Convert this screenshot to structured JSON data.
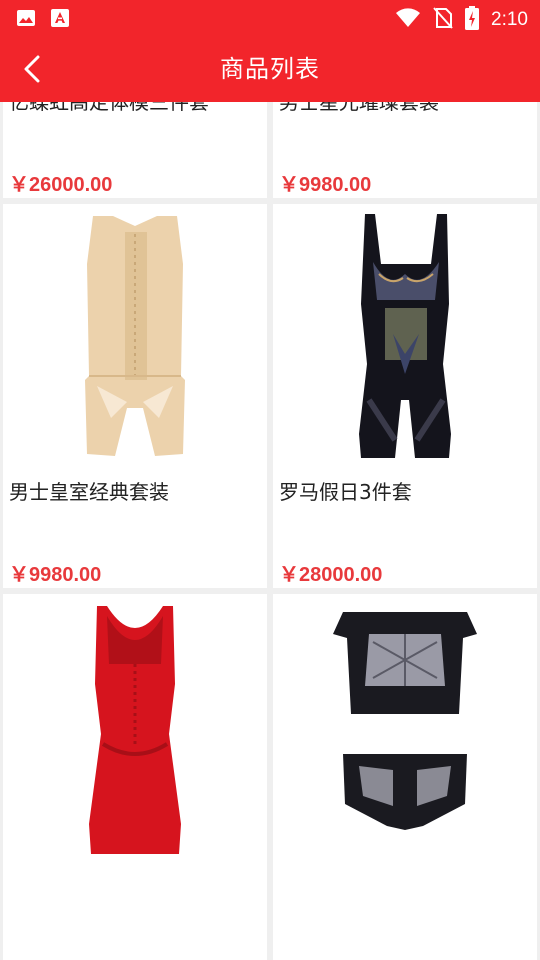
{
  "status_bar": {
    "time": "2:10"
  },
  "app_bar": {
    "title": "商品列表"
  },
  "products": [
    {
      "name": "亿蝶虹高定体模三件套",
      "price": "￥26000.00"
    },
    {
      "name": "男士星光璀璨套装",
      "price": "￥9980.00"
    },
    {
      "name": "男士皇室经典套装",
      "price": "￥9980.00"
    },
    {
      "name": "罗马假日3件套",
      "price": "￥28000.00"
    },
    {
      "name": "",
      "price": ""
    },
    {
      "name": "",
      "price": ""
    }
  ],
  "colors": {
    "brand": "#f2252b",
    "price": "#e8393c",
    "background": "#efefef"
  }
}
